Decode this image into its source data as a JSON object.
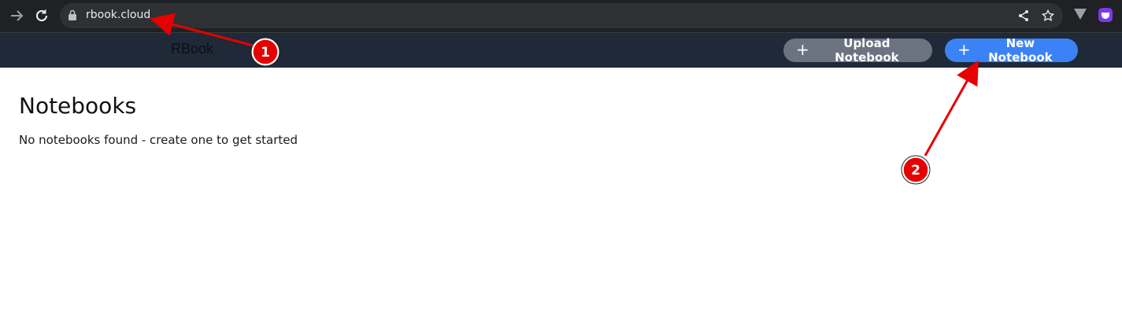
{
  "browser": {
    "url": "rbook.cloud",
    "icons": [
      "forward-arrow-icon",
      "reload-icon",
      "lock-icon",
      "share-icon",
      "star-icon",
      "extension-v-icon",
      "extension-purple-icon"
    ]
  },
  "header": {
    "brand": "RBook",
    "upload_label": "Upload Notebook",
    "new_label": "New Notebook",
    "plus_glyph": "+"
  },
  "main": {
    "title": "Notebooks",
    "empty_message": "No notebooks found - create one to get started"
  },
  "annotations": {
    "badges": [
      "1",
      "2"
    ],
    "color": "#e60000"
  },
  "colors": {
    "header_bg": "#1f2937",
    "upload_button": "#6b7280",
    "new_button": "#3b82f6"
  }
}
